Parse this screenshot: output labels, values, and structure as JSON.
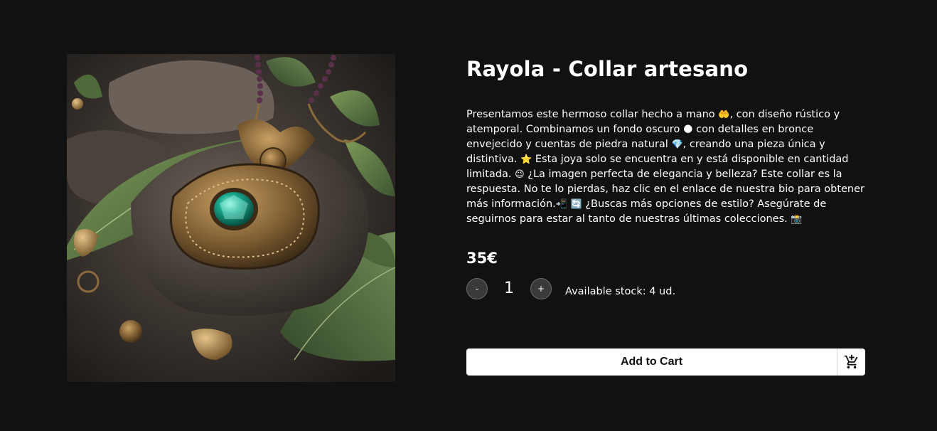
{
  "product": {
    "image_alt": "Rayola - Collar artesano",
    "title": "Rayola - Collar artesano",
    "description": [
      {
        "type": "text",
        "value": "Presentamos este hermoso collar hecho a mano "
      },
      {
        "type": "emoji",
        "value": "🤲",
        "icon": "open-hands-icon"
      },
      {
        "type": "text",
        "value": ", con diseño rústico y atemporal. Combinamos un fondo oscuro "
      },
      {
        "type": "emoji",
        "value": "🌑",
        "icon": "dark-moon-icon"
      },
      {
        "type": "text",
        "value": "  con detalles en bronce envejecido y cuentas de piedra natural "
      },
      {
        "type": "emoji",
        "value": "💎",
        "icon": "gem-icon"
      },
      {
        "type": "text",
        "value": ", creando una pieza única y distintiva. "
      },
      {
        "type": "emoji",
        "value": "⭐",
        "icon": "star-icon"
      },
      {
        "type": "text",
        "value": "  Esta joya solo se encuentra en y está disponible en cantidad limitada. "
      },
      {
        "type": "emoji",
        "value": "😉",
        "icon": "wink-icon"
      },
      {
        "type": "text",
        "value": " ¿La imagen perfecta de elegancia y belleza? Este collar es la respuesta. No te lo pierdas, haz clic en el enlace de nuestra bio para obtener más información."
      },
      {
        "type": "emoji",
        "value": "📲",
        "icon": "mobile-phone-icon"
      },
      {
        "type": "text",
        "value": " "
      },
      {
        "type": "emoji",
        "value": "🔄",
        "icon": "refresh-icon"
      },
      {
        "type": "text",
        "value": "  ¿Buscas más opciones de estilo? Asegúrate de seguirnos para estar al tanto de nuestras últimas colecciones. "
      },
      {
        "type": "emoji",
        "value": "📸",
        "icon": "camera-icon"
      }
    ],
    "price": "35€",
    "quantity": {
      "minus_label": "-",
      "value": "1",
      "plus_label": "+"
    },
    "stock_text": "Available stock: 4 ud.",
    "add_to_cart_label": "Add to Cart",
    "cart_icon": "add-shopping-cart-icon"
  }
}
